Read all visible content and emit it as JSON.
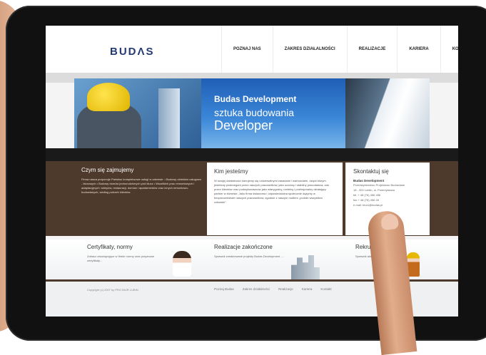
{
  "header": {
    "logo": "BUDΛS",
    "nav": [
      "POZNAJ NAS",
      "ZAKRES DZIAŁALNOŚCI",
      "REALIZACJE",
      "KARIERA",
      "KONTAKT"
    ]
  },
  "banner": {
    "title": "Budas Development",
    "subtitle_1": "sztuka budowania",
    "subtitle_2": "Developer"
  },
  "columns": {
    "czym": {
      "title": "Czym się zajmujemy",
      "text": "Firma nasza proponuje Państwu kompleksowe usługi w zakresie: • Budowy obiektów usługowo - biurowych • Budowy domów jednorodzinnych pod klucz • Wszelkich prac remontowych i adaptacyjnych: sklepów, restauracji, domów i apartamentów oraz innych remontowo- budowlanych, według potrzeb klientów."
    },
    "kim": {
      "title": "Kim jesteśmy",
      "text": "W swojej działalności kierujemy się uniwersalnymi zasadami i wartościami, dzięki którym jesteśmy postrzegani przez naszych pracowników, jako uczciwy i stabilny pracodawca, zaś przez klientów oraz podwykonawców jako wiarygodny, rzetelny i profesjonalny działający partner w biznesie. Jako firma świadoma i odpowiedzialna społecznie dążymy w bezpieczeństwie naszych pracowników, zgodnie z naszym mottem „przede wszystkim człowiek”."
    },
    "kontakt": {
      "title": "Skontaktuj się",
      "company": "Budas Development",
      "company_sub": "Przedsiębiorstwo Projektowo Budowlane",
      "lines": [
        "18 - 300 Lublin, ul. Przemysłowa",
        "tel. + 48 (76) 456 456",
        "fax + 48 (76) 456 45",
        "e-mail: biuro@budas.pl"
      ]
    }
  },
  "lower": {
    "cert": {
      "title": "Certyfikaty, normy",
      "text": "Zobacz obowiązujące w firmie normy oraz przyznane certyfikaty..."
    },
    "real": {
      "title": "Realizacje zakończone",
      "text": "Sprawdź zrealizowane projekty Budas Development ...."
    },
    "rekr": {
      "title": "Rekrutacja",
      "text": "Sprawdź aktualne oferty pracy"
    }
  },
  "footer": {
    "copyright": "Copyright (c) 2007 by PRO BIUR LUBIN",
    "nav": [
      "Poznaj Budas",
      "Zakres działalności",
      "Realizacje",
      "Kariera",
      "Kontakt"
    ]
  }
}
